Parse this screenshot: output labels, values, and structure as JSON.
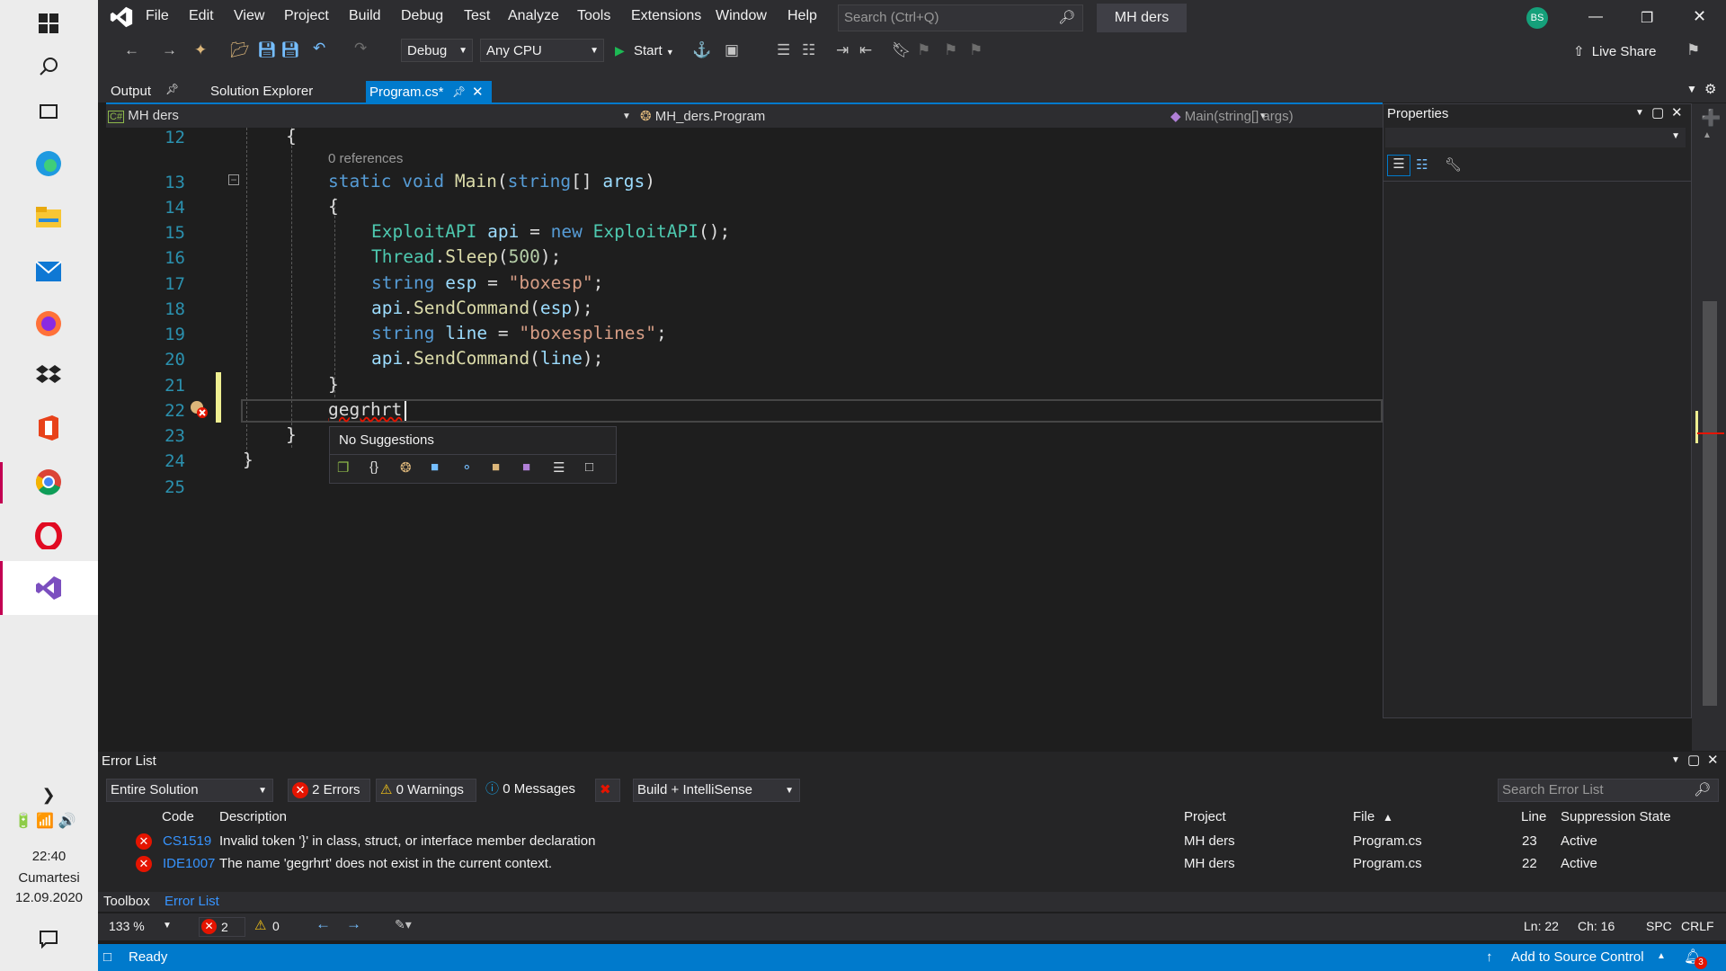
{
  "taskbar": {
    "time": "22:40",
    "day": "Cumartesi",
    "date": "12.09.2020"
  },
  "menu": [
    "File",
    "Edit",
    "View",
    "Project",
    "Build",
    "Debug",
    "Test",
    "Analyze",
    "Tools",
    "Extensions",
    "Window",
    "Help"
  ],
  "search": {
    "placeholder": "Search (Ctrl+Q)"
  },
  "solution_name": "MH ders",
  "user_initials": "BS",
  "toolbar": {
    "config": "Debug",
    "platform": "Any CPU",
    "start": "Start",
    "live_share": "Live Share"
  },
  "tabs": {
    "output": "Output",
    "solution_explorer": "Solution Explorer",
    "active": "Program.cs*"
  },
  "navbar": {
    "project": "MH ders",
    "class": "MH_ders.Program",
    "member": "Main(string[] args)"
  },
  "editor": {
    "line_numbers": [
      "12",
      "13",
      "14",
      "15",
      "16",
      "17",
      "18",
      "19",
      "20",
      "21",
      "22",
      "23",
      "24",
      "25"
    ],
    "references": "0 references",
    "suggestion_text": "No Suggestions"
  },
  "properties": {
    "title": "Properties"
  },
  "error_list": {
    "title": "Error List",
    "scope": "Entire Solution",
    "errors_btn": "2 Errors",
    "warnings_btn": "0 Warnings",
    "messages_btn": "0 Messages",
    "source": "Build + IntelliSense",
    "search_placeholder": "Search Error List",
    "columns": {
      "code": "Code",
      "description": "Description",
      "project": "Project",
      "file": "File",
      "line": "Line",
      "suppression": "Suppression State"
    },
    "rows": [
      {
        "code": "CS1519",
        "description": "Invalid token '}' in class, struct, or interface member declaration",
        "project": "MH ders",
        "file": "Program.cs",
        "line": "23",
        "state": "Active"
      },
      {
        "code": "IDE1007",
        "description": "The name 'gegrhrt' does not exist in the current context.",
        "project": "MH ders",
        "file": "Program.cs",
        "line": "22",
        "state": "Active"
      }
    ]
  },
  "bottom_tabs": {
    "toolbox": "Toolbox",
    "error_list": "Error List"
  },
  "zoom_bar": {
    "zoom": "133 %",
    "errors": "2",
    "warnings": "0",
    "ln": "Ln: 22",
    "ch": "Ch: 16",
    "spc": "SPC",
    "crlf": "CRLF"
  },
  "status": {
    "ready": "Ready",
    "source_control": "Add to Source Control",
    "notifications": "3"
  }
}
